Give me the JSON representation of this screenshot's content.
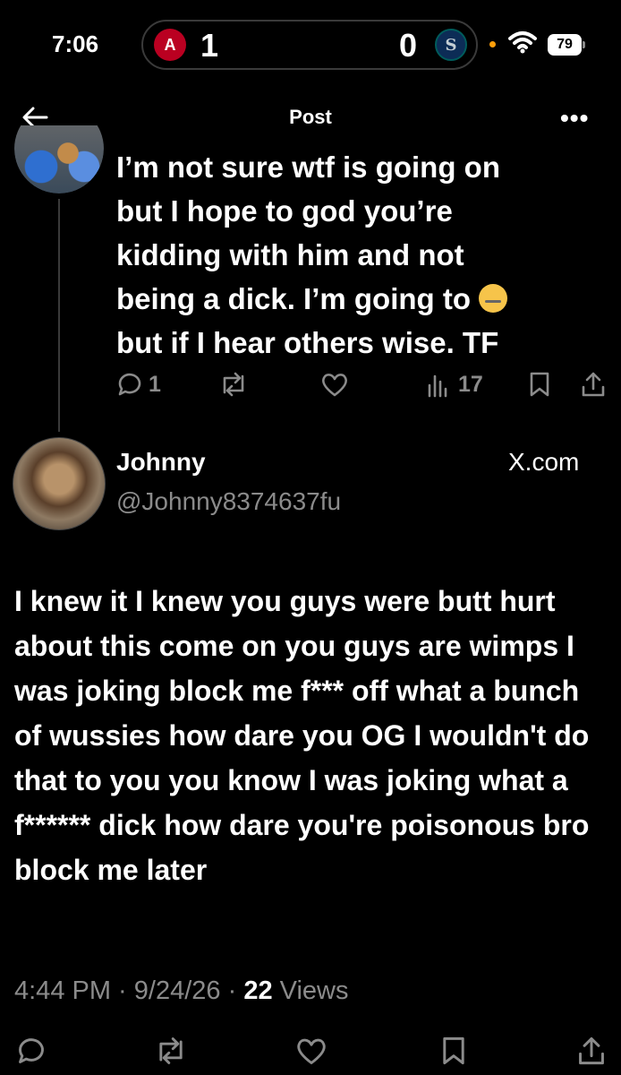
{
  "status_bar": {
    "time": "7:06",
    "home_score": "1",
    "away_score": "0",
    "home_logo": "A",
    "away_logo": "S",
    "battery": "79"
  },
  "nav": {
    "title": "Post",
    "more": "•••"
  },
  "parent_tweet": {
    "line1": "I’m not sure wtf is going on",
    "line2": "but I hope to god you’re",
    "line3": "kidding with him and not",
    "line4": "being a dick. I’m going to",
    "line5": "but if I hear others wise. TF",
    "replies": "1",
    "views": "17"
  },
  "main_tweet": {
    "author_name": "Johnny",
    "author_handle": "@Johnny8374637fu",
    "source": "X.com",
    "text": "I knew it I knew you guys were butt hurt about this come on you guys are wimps I was joking block me f*** off what a bunch of wussies how dare you OG I wouldn't do that to you you know I was joking what a f****** dick how dare you're poisonous bro block me later",
    "time": "4:44 PM",
    "date": "9/24/26",
    "views_count": "22",
    "views_label": "Views"
  },
  "colors": {
    "background": "#000000",
    "muted": "#8b8b8b",
    "angels_red": "#ba0021",
    "mariners_navy": "#0c2c56"
  },
  "icons": [
    "back-arrow-icon",
    "more-icon",
    "reply-icon",
    "repost-icon",
    "like-icon",
    "views-icon",
    "bookmark-icon",
    "share-icon",
    "wifi-icon",
    "zipper-mouth-emoji"
  ]
}
